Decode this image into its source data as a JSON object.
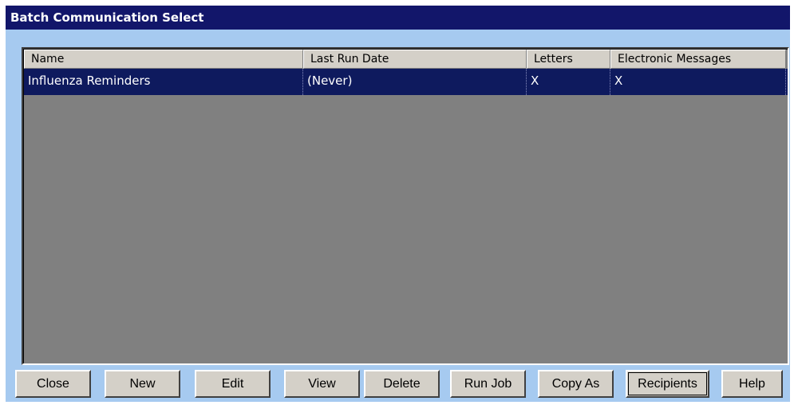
{
  "window": {
    "title": "Batch Communication Select"
  },
  "list": {
    "columns": [
      "Name",
      "Last Run Date",
      "Letters",
      "Electronic Messages"
    ],
    "rows": [
      {
        "name": "Influenza Reminders",
        "last_run_date": "(Never)",
        "letters": "X",
        "electronic_messages": "X",
        "selected": true
      }
    ]
  },
  "buttons": {
    "close": "Close",
    "new": "New",
    "edit": "Edit",
    "view": "View",
    "delete": "Delete",
    "run_job": "Run Job",
    "copy_as": "Copy As",
    "recipients": "Recipients",
    "help": "Help"
  },
  "colors": {
    "title_bar": "#12166a",
    "selected_row": "#0e1a5e",
    "list_background": "#808080",
    "window_background": "#a6caf0"
  }
}
